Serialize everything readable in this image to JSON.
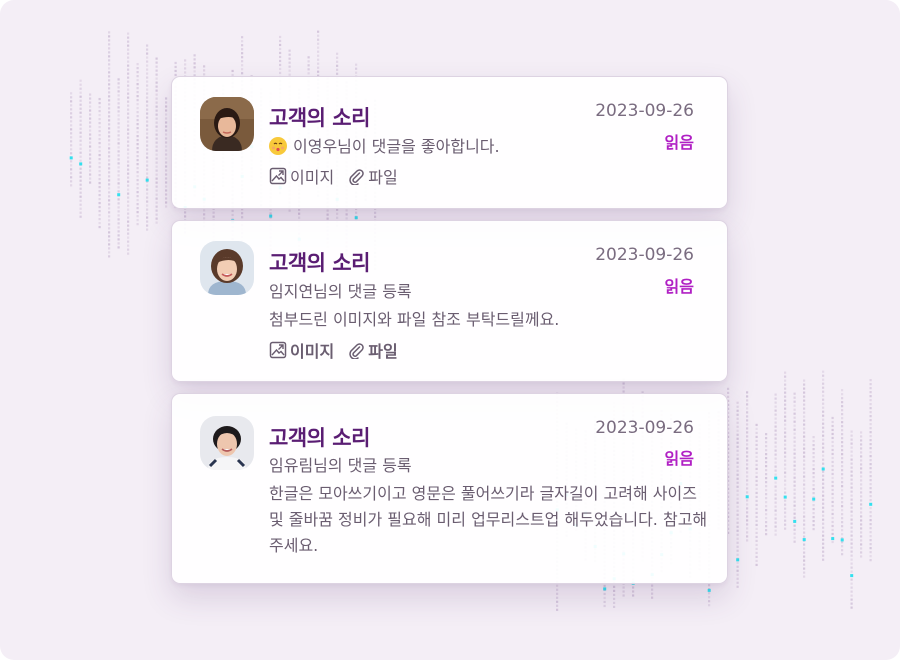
{
  "notifications": [
    {
      "title": "고객의 소리",
      "date": "2023-09-26",
      "status": "읽음",
      "line1": "이영우님이 댓글을 좋아합니다.",
      "line1_icon": "kiss-emoji-icon",
      "attachments": {
        "image_label": "이미지",
        "file_label": "파일"
      }
    },
    {
      "title": "고객의 소리",
      "date": "2023-09-26",
      "status": "읽음",
      "line1": "임지연님의 댓글 등록",
      "body": "첨부드린 이미지와 파일 참조 부탁드릴께요.",
      "attachments": {
        "image_label": "이미지",
        "file_label": "파일"
      }
    },
    {
      "title": "고객의 소리",
      "date": "2023-09-26",
      "status": "읽음",
      "line1": "임유림님의 댓글 등록",
      "body": "한글은 모아쓰기이고 영문은 풀어쓰기라 글자길이 고려해 사이즈 및 줄바꿈 정비가 필요해 미리 업무리스트업 해두었습니다. 참고해주세요."
    }
  ],
  "colors": {
    "background": "#f4eef6",
    "title": "#5a1d73",
    "status": "#b01fc4",
    "text": "#6a5d70",
    "accent_dots": "#33e0ee"
  }
}
